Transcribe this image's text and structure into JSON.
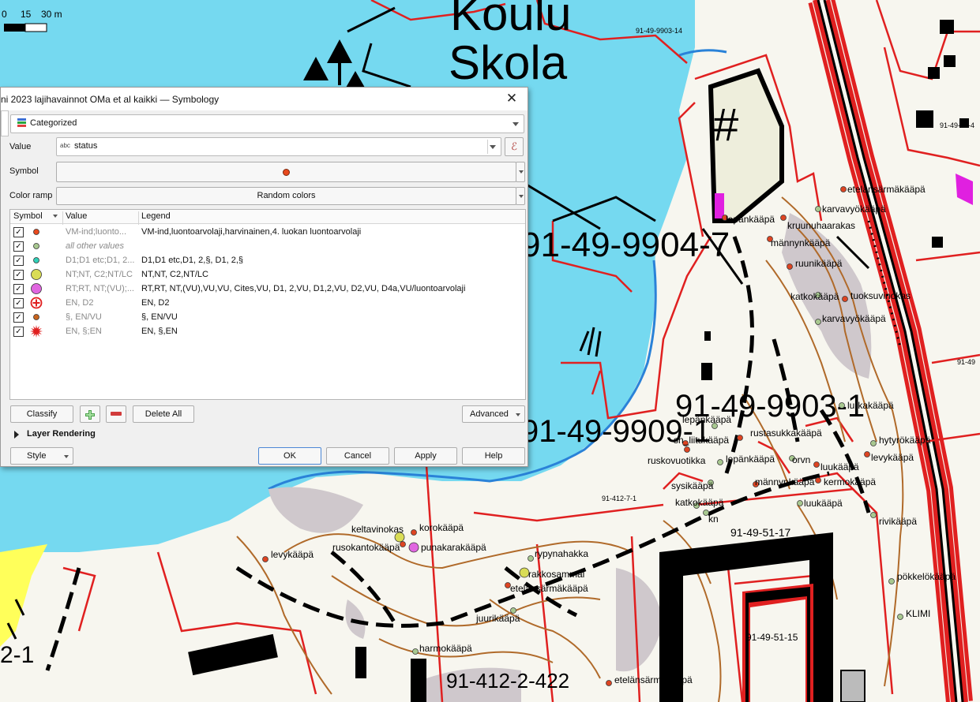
{
  "map": {
    "scale_labels": [
      "0",
      "15",
      "30 m"
    ],
    "place_labels": [
      "Koulu",
      "Skola"
    ],
    "parcel_labels": [
      "91-49-9904-7",
      "91-49-9903-1",
      "91-49-9909-1",
      "91-412-2-422",
      "91-49-51-17",
      "91-49-51-15",
      "91-49-9903-14",
      "91-49-38-4",
      "91-412-7-1",
      "91-49",
      "2-1"
    ],
    "observations": [
      {
        "name": "etelänsärmäkääpä",
        "color": "#dd4422"
      },
      {
        "name": "karvavyökääpä",
        "color": "#a8c890"
      },
      {
        "name": "lepänkääpä",
        "color": "#dd4422"
      },
      {
        "name": "kruunuhaarakas",
        "color": "#dd4422"
      },
      {
        "name": "männynkääpä",
        "color": "#dd4422"
      },
      {
        "name": "ruunikääpä",
        "color": "#dd4422"
      },
      {
        "name": "katkokääpä",
        "color": "#a8c890"
      },
      {
        "name": "tuoksuvinokas",
        "color": "#dd4422"
      },
      {
        "name": "karvavyökääpä",
        "color": "#a8c890"
      },
      {
        "name": "lepänkääpä",
        "color": "#a8c890"
      },
      {
        "name": "sn_liitukääpä",
        "color": "#dd4422"
      },
      {
        "name": "rustasukkakääpä",
        "color": "#dd4422"
      },
      {
        "name": "ruskovuotikka",
        "color": "#dd4422"
      },
      {
        "name": "lepänkääpä",
        "color": "#a8c890"
      },
      {
        "name": "orvn",
        "color": "#a8c890"
      },
      {
        "name": "luukääpä",
        "color": "#dd4422"
      },
      {
        "name": "sysikääpä",
        "color": "#a8c890"
      },
      {
        "name": "männynkääpä",
        "color": "#dd4422"
      },
      {
        "name": "kermokääpä",
        "color": "#dd4422"
      },
      {
        "name": "katkokääpä",
        "color": "#a8c890"
      },
      {
        "name": "kn",
        "color": "#a8c890"
      },
      {
        "name": "luukääpä",
        "color": "#a8c890"
      },
      {
        "name": "hytyrökääpä",
        "color": "#a8c890"
      },
      {
        "name": "levykääpä",
        "color": "#dd4422"
      },
      {
        "name": "rivikääpä",
        "color": "#a8c890"
      },
      {
        "name": "lurkakääpä",
        "color": "#a8c890"
      },
      {
        "name": "keltavinokas",
        "color": "#d9dc55"
      },
      {
        "name": "korokääpä",
        "color": "#dd4422"
      },
      {
        "name": "rusokantokääpä",
        "color": "#dd4422"
      },
      {
        "name": "punakarakääpä",
        "color": "#e066e0"
      },
      {
        "name": "levykääpä",
        "color": "#dd4422"
      },
      {
        "name": "rypynahakka",
        "color": "#a8c890"
      },
      {
        "name": "rakkosammal",
        "color": "#d9dc55"
      },
      {
        "name": "etelänsärmäkääpä",
        "color": "#dd4422"
      },
      {
        "name": "juurikääpä",
        "color": "#a8c890"
      },
      {
        "name": "harmokääpä",
        "color": "#a8c890"
      },
      {
        "name": "etelänsärmäkääpä",
        "color": "#dd4422"
      },
      {
        "name": "pökkelökääpä",
        "color": "#a8c890"
      },
      {
        "name": "KLIMI",
        "color": "#a8c890"
      }
    ]
  },
  "dialog": {
    "title": "ni 2023 lajihavainnot OMa et al kaikki — Symbology",
    "renderer": "Categorized",
    "value_label": "Value",
    "value_type": "abc",
    "value_field": "status",
    "symbol_label": "Symbol",
    "color_ramp_label": "Color ramp",
    "color_ramp": "Random colors",
    "columns": [
      "Symbol",
      "Value",
      "Legend"
    ],
    "rows": [
      {
        "checked": "✓",
        "symbol": "dot",
        "color": "#e8491d",
        "value": "VM-ind;luonto...",
        "legend": "VM-ind,luontoarvolaji,harvinainen,4. luokan luontoarvolaji"
      },
      {
        "checked": "✓",
        "symbol": "dot",
        "color": "#a8c890",
        "value": "all other values",
        "legend": ""
      },
      {
        "checked": "✓",
        "symbol": "dot",
        "color": "#2fd0b8",
        "value": "D1;D1 etc;D1, 2...",
        "legend": "D1,D1 etc,D1, 2,§, D1, 2,§"
      },
      {
        "checked": "✓",
        "symbol": "bigdot",
        "color": "#d9dc55",
        "value": "NT;NT, C2;NT/LC",
        "legend": "NT,NT, C2,NT/LC"
      },
      {
        "checked": "✓",
        "symbol": "bigdot",
        "color": "#e066e0",
        "value": "RT;RT, NT;(VU);...",
        "legend": "RT,RT, NT,(VU),VU,VU, Cites,VU, D1, 2,VU, D1,2,VU, D2,VU, D4a,VU/luontoarvolaji"
      },
      {
        "checked": "✓",
        "symbol": "cross",
        "color": "#e02020",
        "value": "EN, D2",
        "legend": "EN, D2"
      },
      {
        "checked": "✓",
        "symbol": "dot",
        "color": "#c8641e",
        "value": "§, EN/VU",
        "legend": "§, EN/VU"
      },
      {
        "checked": "✓",
        "symbol": "star",
        "color": "#e02020",
        "value": "EN, §;EN",
        "legend": "EN, §,EN"
      }
    ],
    "buttons": {
      "classify": "Classify",
      "delete_all": "Delete All",
      "advanced": "Advanced",
      "layer_rendering": "Layer Rendering",
      "style": "Style",
      "ok": "OK",
      "cancel": "Cancel",
      "apply": "Apply",
      "help": "Help"
    }
  }
}
